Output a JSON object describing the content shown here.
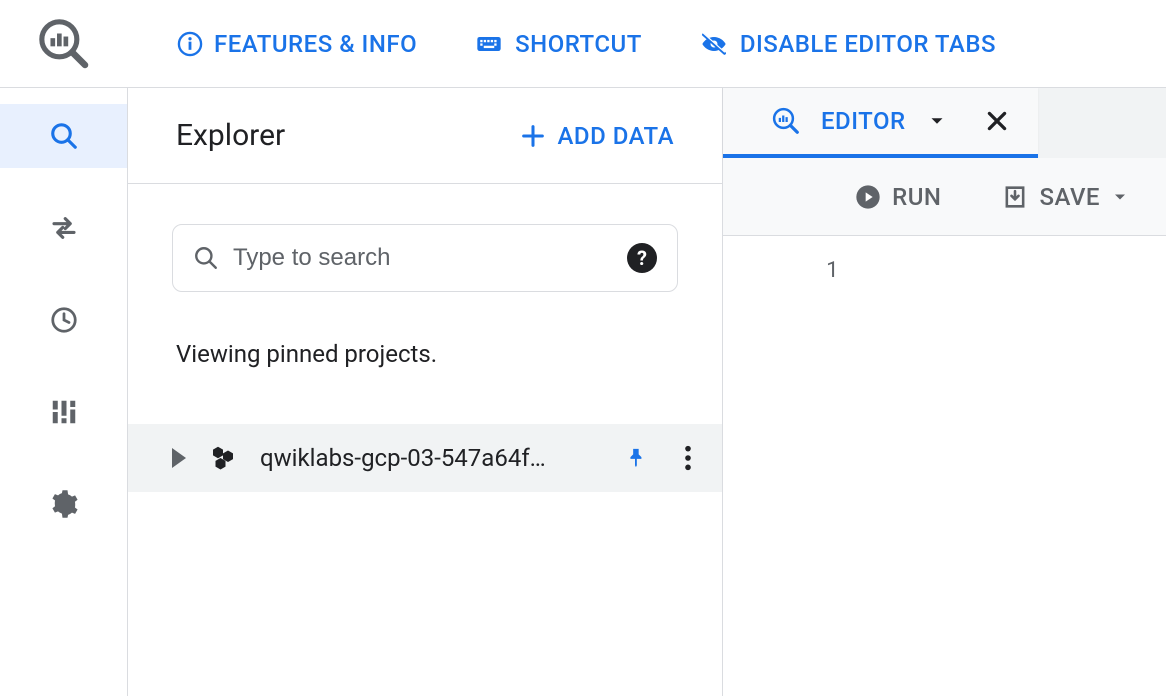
{
  "header": {
    "features_label": "FEATURES & INFO",
    "shortcut_label": "SHORTCUT",
    "disable_tabs_label": "DISABLE EDITOR TABS"
  },
  "explorer": {
    "title": "Explorer",
    "add_data_label": "ADD DATA",
    "search_placeholder": "Type to search",
    "pinned_message": "Viewing pinned projects.",
    "project_name": "qwiklabs-gcp-03-547a64f…"
  },
  "editor_panel": {
    "tab_label": "EDITOR",
    "run_label": "RUN",
    "save_label": "SAVE",
    "line_number": "1"
  }
}
